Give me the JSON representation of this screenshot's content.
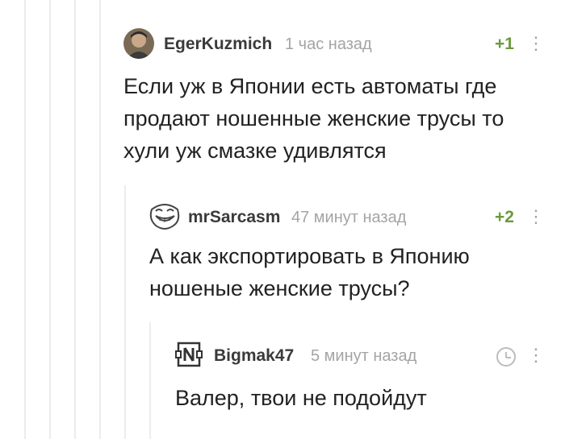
{
  "colors": {
    "rating": "#6b9a3c",
    "time": "#a4a4a4",
    "username": "#3a3a3a",
    "thread_line": "#ececec"
  },
  "comments": [
    {
      "username": "EgerKuzmich",
      "time": "1 час назад",
      "rating": "+1",
      "text_lines": [
        "Если уж в Японии есть автоматы где",
        "продают ношенные женские трусы то",
        "хули уж смазке удивлятся"
      ],
      "avatar_icon": "user-photo-avatar"
    },
    {
      "username": "mrSarcasm",
      "time": "47 минут назад",
      "rating": "+2",
      "text_lines": [
        "А как экспортировать в Японию",
        "ношеные женские трусы?"
      ],
      "avatar_icon": "trollface-avatar"
    },
    {
      "username": "Bigmak47",
      "time": "5 минут назад",
      "rating": "",
      "text_lines": [
        "Валер, твои не подойдут"
      ],
      "avatar_icon": "rammstein-logo-avatar"
    }
  ],
  "more_icon": "⋮"
}
